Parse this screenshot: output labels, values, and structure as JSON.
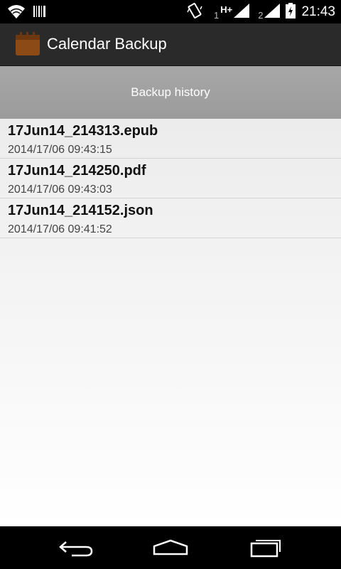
{
  "status_bar": {
    "time": "21:43",
    "sim1_label": "1",
    "sim1_network": "H+",
    "sim2_label": "2",
    "icons": [
      "wifi-icon",
      "barcode-icon",
      "vibrate-icon",
      "signal-icon",
      "signal-icon",
      "battery-charging-icon"
    ]
  },
  "action_bar": {
    "title": "Calendar Backup",
    "icon": "calendar-backup-app-icon",
    "icon_color": "#8b4a16"
  },
  "history_button": {
    "label": "Backup history"
  },
  "backups": [
    {
      "name": "17Jun14_214313.epub",
      "date": "2014/17/06 09:43:15"
    },
    {
      "name": "17Jun14_214250.pdf",
      "date": "2014/17/06 09:43:03"
    },
    {
      "name": "17Jun14_214152.json",
      "date": "2014/17/06 09:41:52"
    }
  ],
  "nav_bar": {
    "icons": [
      "back-icon",
      "home-icon",
      "recent-apps-icon"
    ]
  }
}
